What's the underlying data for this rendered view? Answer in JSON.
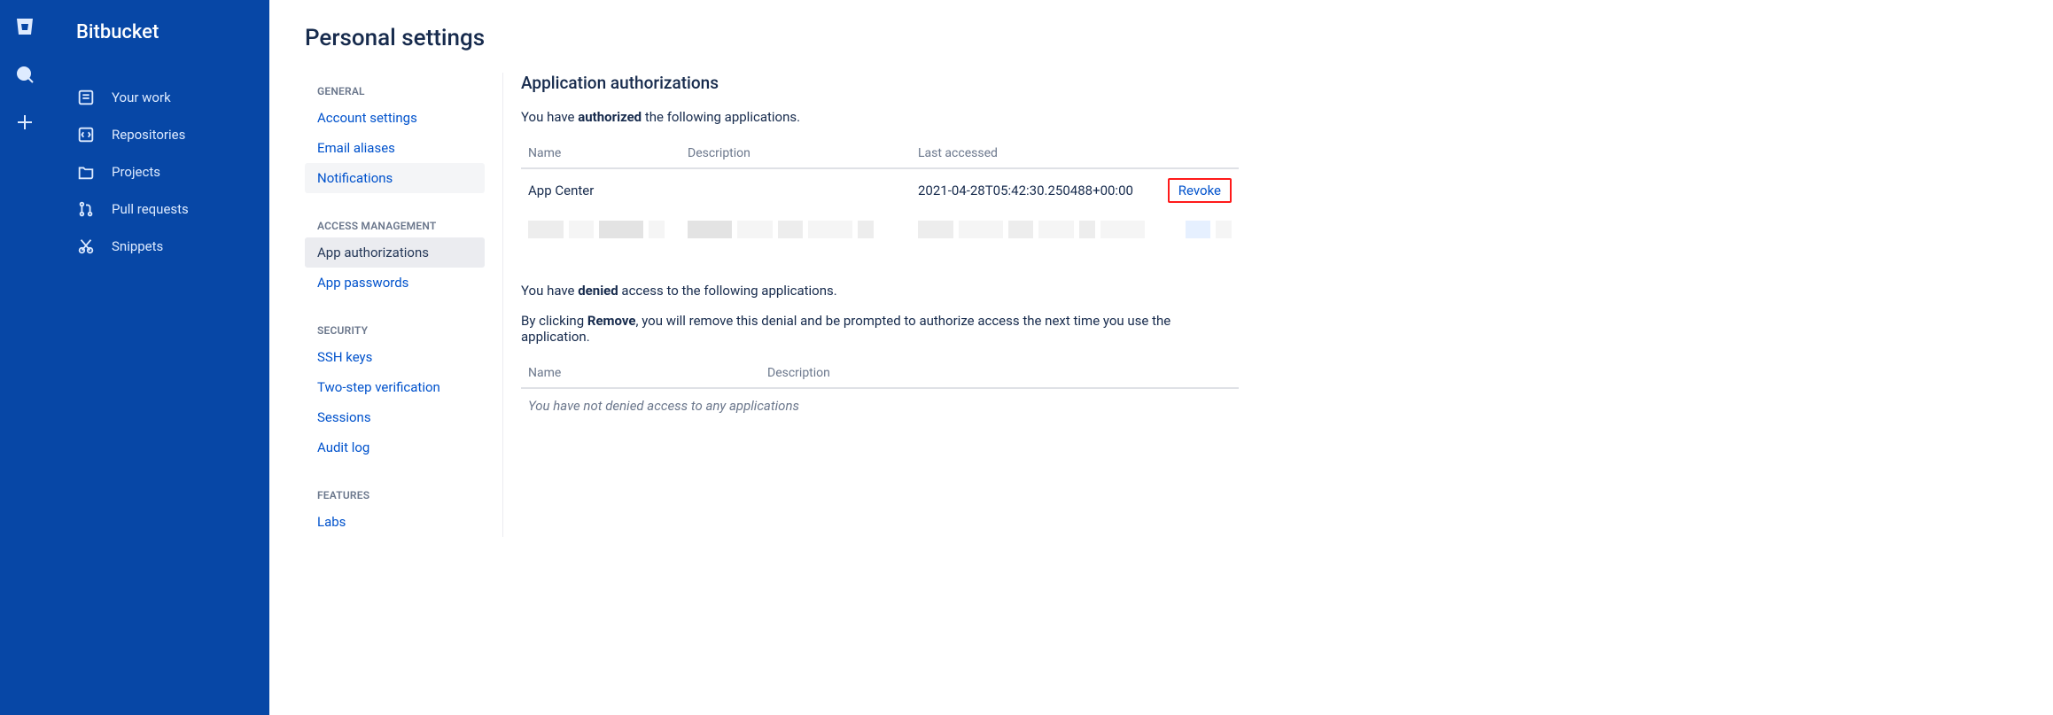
{
  "brand": {
    "name": "Bitbucket"
  },
  "productNav": {
    "items": [
      {
        "label": "Your work"
      },
      {
        "label": "Repositories"
      },
      {
        "label": "Projects"
      },
      {
        "label": "Pull requests"
      },
      {
        "label": "Snippets"
      }
    ]
  },
  "page": {
    "title": "Personal settings"
  },
  "settingsNav": {
    "groups": [
      {
        "label": "GENERAL",
        "items": [
          {
            "label": "Account settings"
          },
          {
            "label": "Email aliases"
          },
          {
            "label": "Notifications"
          }
        ]
      },
      {
        "label": "ACCESS MANAGEMENT",
        "items": [
          {
            "label": "App authorizations"
          },
          {
            "label": "App passwords"
          }
        ]
      },
      {
        "label": "SECURITY",
        "items": [
          {
            "label": "SSH keys"
          },
          {
            "label": "Two-step verification"
          },
          {
            "label": "Sessions"
          },
          {
            "label": "Audit log"
          }
        ]
      },
      {
        "label": "FEATURES",
        "items": [
          {
            "label": "Labs"
          }
        ]
      }
    ]
  },
  "panel": {
    "heading": "Application authorizations",
    "authorized_sentence_pre": "You have ",
    "authorized_bold": "authorized",
    "authorized_sentence_post": " the following applications.",
    "table": {
      "headers": {
        "name": "Name",
        "description": "Description",
        "last_accessed": "Last accessed"
      },
      "rows": [
        {
          "name": "App Center",
          "description": "",
          "last_accessed": "2021-04-28T05:42:30.250488+00:00",
          "action": "Revoke"
        }
      ]
    },
    "denied_sentence_pre": "You have ",
    "denied_bold": "denied",
    "denied_sentence_post": " access to the following applications.",
    "remove_sentence_pre": "By clicking ",
    "remove_bold": "Remove",
    "remove_sentence_post": ", you will remove this denial and be prompted to authorize access the next time you use the application.",
    "denied_table": {
      "headers": {
        "name": "Name",
        "description": "Description"
      },
      "empty": "You have not denied access to any applications"
    }
  }
}
